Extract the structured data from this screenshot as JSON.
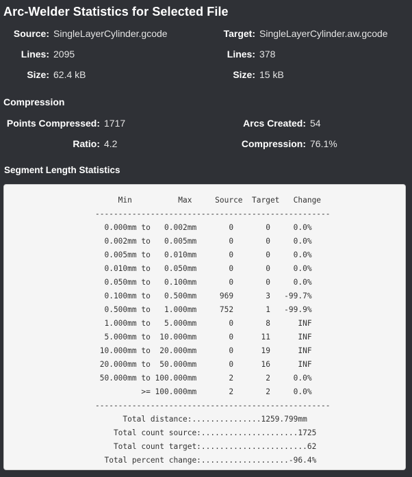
{
  "title": "Arc-Welder Statistics for Selected File",
  "source": {
    "label": "Source:",
    "value": "SingleLayerCylinder.gcode",
    "lines_label": "Lines:",
    "lines_value": "2095",
    "size_label": "Size:",
    "size_value": "62.4 kB"
  },
  "target": {
    "label": "Target:",
    "value": "SingleLayerCylinder.aw.gcode",
    "lines_label": "Lines:",
    "lines_value": "378",
    "size_label": "Size:",
    "size_value": "15 kB"
  },
  "compression": {
    "heading": "Compression",
    "points_label": "Points Compressed:",
    "points_value": "1717",
    "arcs_label": "Arcs Created:",
    "arcs_value": "54",
    "ratio_label": "Ratio:",
    "ratio_value": "4.2",
    "compression_label": "Compression:",
    "compression_value": "76.1%"
  },
  "segment_stats": {
    "heading": "Segment Length Statistics",
    "text": "     Min          Max     Source  Target   Change\n---------------------------------------------------\n  0.000mm to   0.002mm       0       0     0.0%\n  0.002mm to   0.005mm       0       0     0.0%\n  0.005mm to   0.010mm       0       0     0.0%\n  0.010mm to   0.050mm       0       0     0.0%\n  0.050mm to   0.100mm       0       0     0.0%\n  0.100mm to   0.500mm     969       3   -99.7%\n  0.500mm to   1.000mm     752       1   -99.9%\n  1.000mm to   5.000mm       0       8      INF\n  5.000mm to  10.000mm       0      11      INF\n 10.000mm to  20.000mm       0      19      INF\n 20.000mm to  50.000mm       0      16      INF\n 50.000mm to 100.000mm       2       2     0.0%\n          >= 100.000mm       2       2     0.0%\n---------------------------------------------------\n      Total distance:...............1259.799mm\n    Total count source:.....................1725\n    Total count target:.......................62\n  Total percent change:...................-96.4%"
  }
}
